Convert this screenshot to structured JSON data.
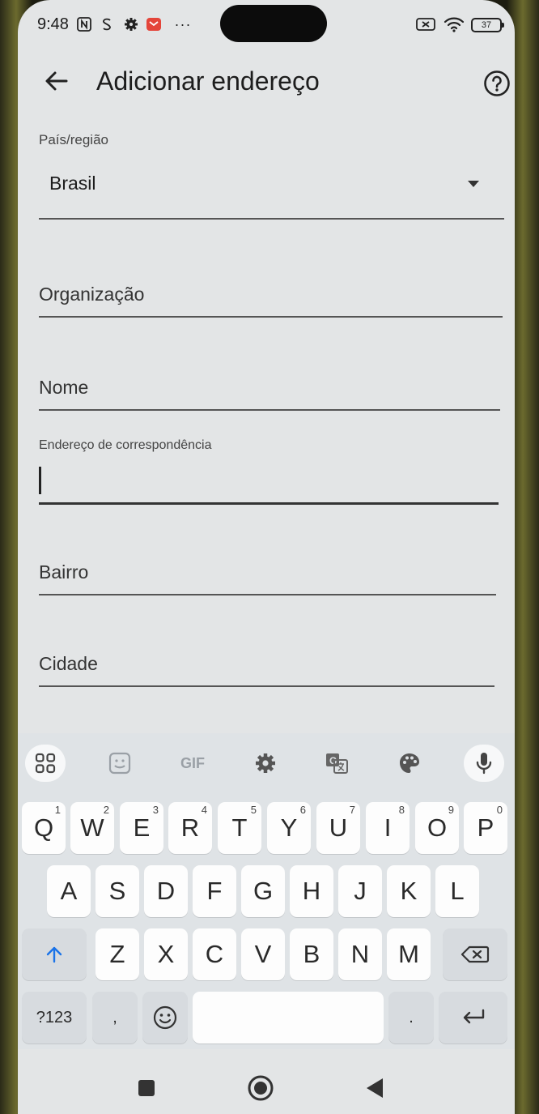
{
  "status_bar": {
    "time": "9:48",
    "battery": "37",
    "left_icons": [
      "nfc-icon",
      "sync-icon",
      "settings-icon",
      "mail-icon",
      "more-icon"
    ],
    "right_icons": [
      "no-sim-icon",
      "wifi-icon",
      "battery-icon"
    ]
  },
  "header": {
    "title": "Adicionar endereço"
  },
  "form": {
    "country_label": "País/região",
    "country_value": "Brasil",
    "organization_placeholder": "Organização",
    "name_placeholder": "Nome",
    "address_label": "Endereço de correspondência",
    "address_value": "",
    "neighborhood_placeholder": "Bairro",
    "city_placeholder": "Cidade"
  },
  "keyboard": {
    "toolbar": [
      "apps-icon",
      "sticker-icon",
      "GIF",
      "settings-icon",
      "translate-icon",
      "palette-icon",
      "mic-icon"
    ],
    "gif_label": "GIF",
    "row1": [
      {
        "key": "Q",
        "hint": "1"
      },
      {
        "key": "W",
        "hint": "2"
      },
      {
        "key": "E",
        "hint": "3"
      },
      {
        "key": "R",
        "hint": "4"
      },
      {
        "key": "T",
        "hint": "5"
      },
      {
        "key": "Y",
        "hint": "6"
      },
      {
        "key": "U",
        "hint": "7"
      },
      {
        "key": "I",
        "hint": "8"
      },
      {
        "key": "O",
        "hint": "9"
      },
      {
        "key": "P",
        "hint": "0"
      }
    ],
    "row2": [
      "A",
      "S",
      "D",
      "F",
      "G",
      "H",
      "J",
      "K",
      "L"
    ],
    "row3": [
      "Z",
      "X",
      "C",
      "V",
      "B",
      "N",
      "M"
    ],
    "symbols_label": "?123",
    "comma_label": ",",
    "period_label": "."
  },
  "colors": {
    "background": "#e3e5e6",
    "key": "#fdfdfd",
    "accent": "#1a73e8"
  }
}
